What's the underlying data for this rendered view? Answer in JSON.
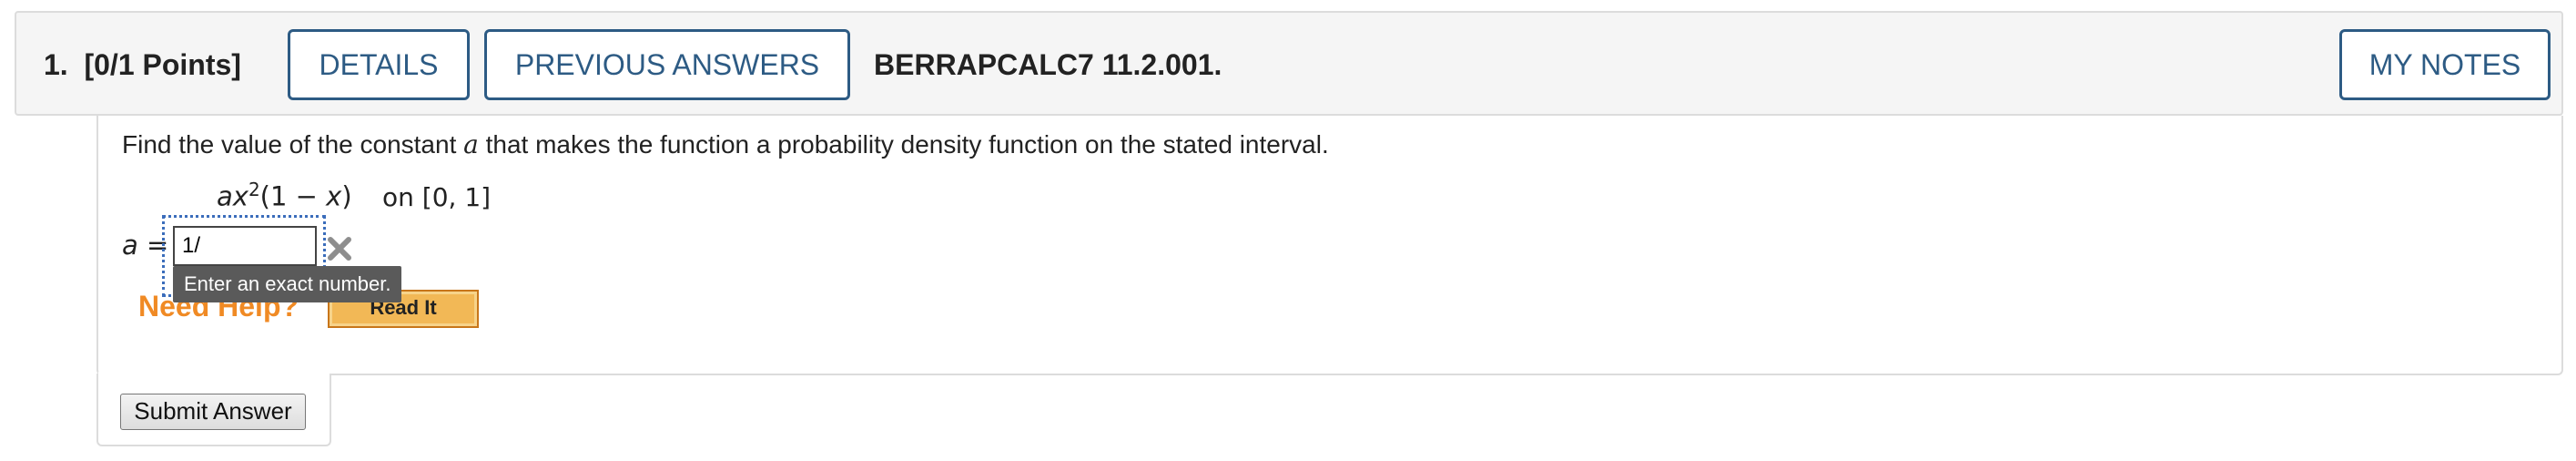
{
  "header": {
    "question_number": "1.",
    "points": "[0/1 Points]",
    "details_label": "DETAILS",
    "previous_answers_label": "PREVIOUS ANSWERS",
    "course_code": "BERRAPCALC7 11.2.001.",
    "my_notes_label": "MY NOTES",
    "accent_color": "#2d5b84"
  },
  "question": {
    "prompt_before": "Find the value of the constant ",
    "prompt_var": "a",
    "prompt_after": " that makes the function a probability density function on the stated interval.",
    "formula_coef": "ax",
    "formula_exp": "2",
    "formula_rest_open": "(1 − ",
    "formula_x": "x",
    "formula_rest_close": ")",
    "interval": "on [0, 1]"
  },
  "answer": {
    "label_var": "a",
    "label_eq": " =",
    "value": "1/",
    "tooltip": "Enter an exact number.",
    "clear_icon": "close-x-icon"
  },
  "help": {
    "need_help_label": "Need Help?",
    "read_it_label": "Read It",
    "need_help_color": "#f08a24"
  },
  "submit": {
    "label": "Submit Answer"
  }
}
